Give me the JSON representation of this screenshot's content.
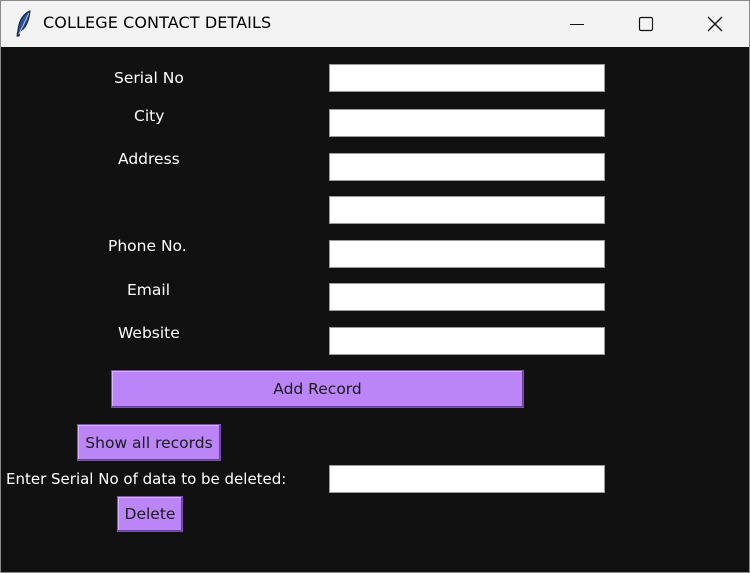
{
  "window": {
    "title": "COLLEGE CONTACT DETAILS"
  },
  "form": {
    "serial_no_label": "Serial No",
    "city_label": "City",
    "address_label": "Address",
    "phone_label": "Phone No.",
    "email_label": "Email",
    "website_label": "Website",
    "serial_no_value": "",
    "city_value": "",
    "address_line1_value": "",
    "address_line2_value": "",
    "phone_value": "",
    "email_value": "",
    "website_value": ""
  },
  "actions": {
    "add_record_label": "Add Record",
    "show_all_label": "Show all records",
    "delete_prompt_label": "Enter Serial No of data to be deleted:",
    "delete_serial_value": "",
    "delete_label": "Delete"
  },
  "colors": {
    "background": "#111111",
    "button": "#bb84f7",
    "titlebar": "#f3f3f3"
  },
  "icons": {
    "app": "feather-icon",
    "minimize": "minimize-icon",
    "maximize": "maximize-icon",
    "close": "close-icon"
  }
}
